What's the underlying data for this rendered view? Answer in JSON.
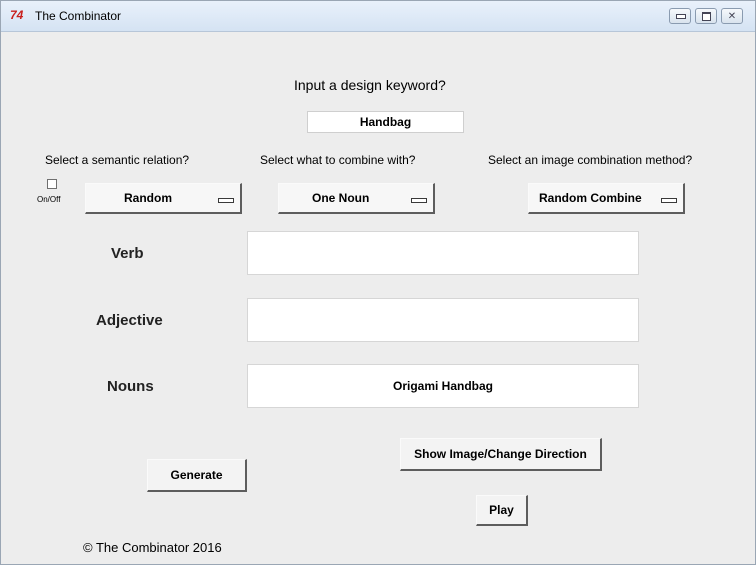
{
  "window": {
    "app_icon_text": "74",
    "title": "The Combinator"
  },
  "main": {
    "keyword_prompt": "Input a design keyword?",
    "keyword_value": "Handbag",
    "semantic_relation_label": "Select a semantic relation?",
    "combine_with_label": "Select what to combine with?",
    "image_method_label": "Select an image combination method?",
    "on_off_label": "On/Off",
    "on_off_checked": false,
    "semantic_relation_value": "Random",
    "combine_with_value": "One Noun",
    "image_method_value": "Random Combine",
    "fields": {
      "verb_label": "Verb",
      "verb_value": "",
      "adjective_label": "Adjective",
      "adjective_value": "",
      "nouns_label": "Nouns",
      "nouns_value": "Origami Handbag"
    },
    "buttons": {
      "show_image": "Show Image/Change Direction",
      "generate": "Generate",
      "play": "Play"
    },
    "copyright": "© The Combinator 2016"
  }
}
